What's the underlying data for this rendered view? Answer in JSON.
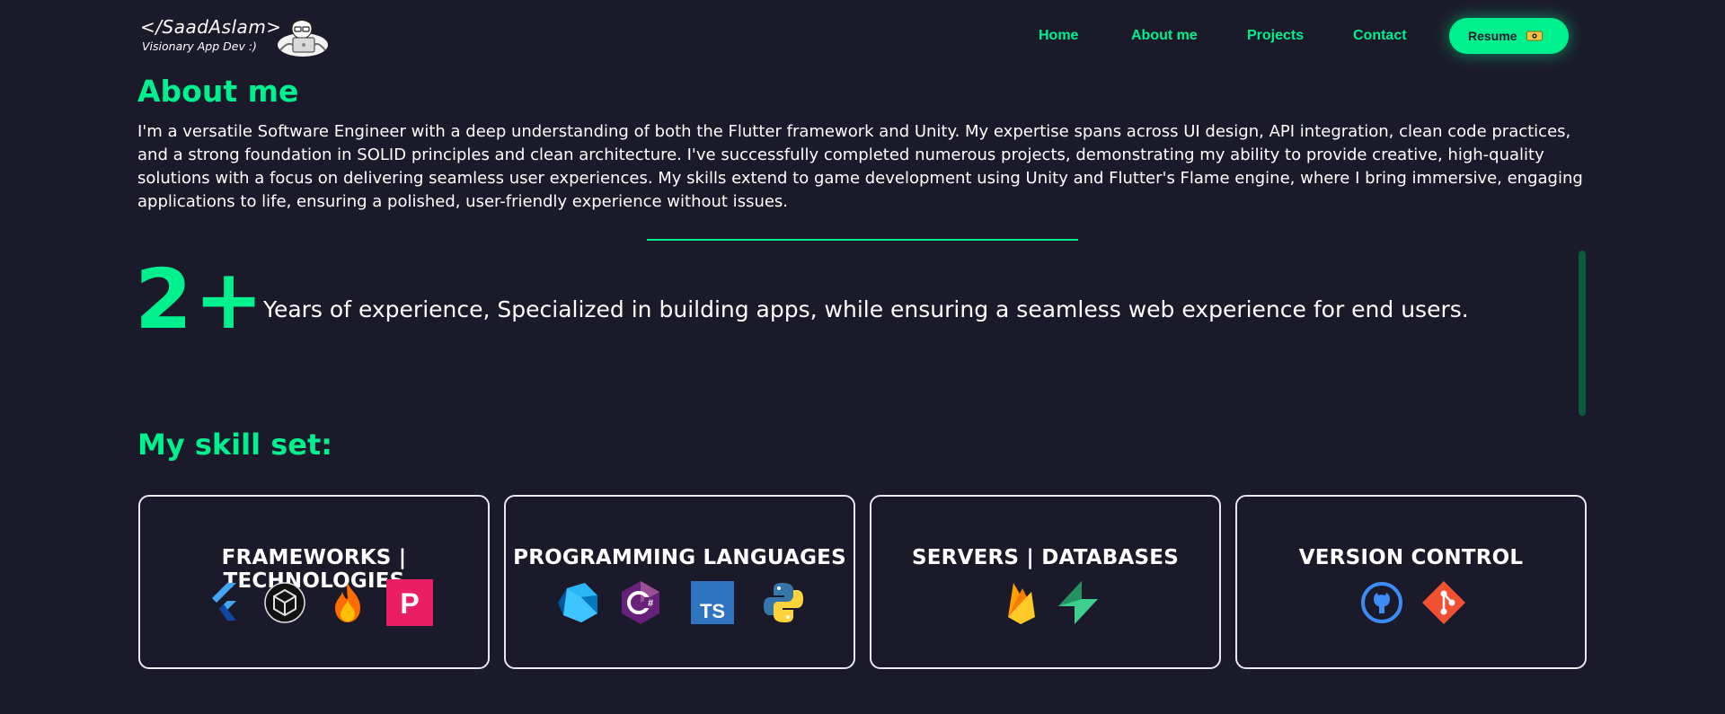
{
  "header": {
    "logo_title": "</SaadAslam>",
    "logo_subtitle": "Visionary App Dev :)",
    "avatar_icon": "developer-avatar-icon",
    "nav": [
      {
        "label": "Home"
      },
      {
        "label": "About me"
      },
      {
        "label": "Projects"
      },
      {
        "label": "Contact"
      }
    ],
    "resume_label": "Resume",
    "resume_icon": "download-icon",
    "accent_color": "#00f08e"
  },
  "about": {
    "title": "About me",
    "text": "I'm a versatile Software Engineer with a deep understanding of both the Flutter framework and Unity. My expertise spans across UI design, API integration, clean code practices, and a strong foundation in SOLID principles and clean architecture. I've successfully completed numerous projects, demonstrating my ability to provide creative, high-quality solutions with a focus on delivering seamless user experiences. My skills extend to game development using Unity and Flutter's Flame engine, where I bring immersive, engaging applications to life, ensuring a polished, user-friendly experience without issues."
  },
  "experience": {
    "number": "2+",
    "text": "Years of experience, Specialized in building apps, while ensuring a seamless web experience for end users."
  },
  "skills": {
    "title": "My skill set:",
    "cards": [
      {
        "title": "FRAMEWORKS | TECHNOLOGIES",
        "icons": [
          "flutter-icon",
          "unity-icon",
          "flame-icon",
          "pocketbase-icon"
        ]
      },
      {
        "title": "PROGRAMMING LANGUAGES",
        "icons": [
          "dart-icon",
          "csharp-icon",
          "typescript-icon",
          "python-icon"
        ]
      },
      {
        "title": "SERVERS | DATABASES",
        "icons": [
          "firebase-icon",
          "supabase-icon"
        ]
      },
      {
        "title": "VERSION CONTROL",
        "icons": [
          "github-icon",
          "git-icon"
        ]
      }
    ],
    "ts_badge": "TS",
    "pb_badge": "P",
    "cs_badge": "C#"
  }
}
